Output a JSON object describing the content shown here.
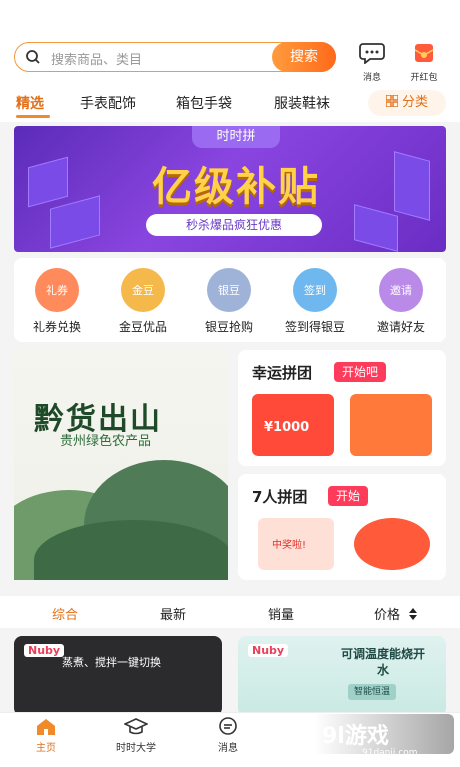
{
  "search": {
    "placeholder": "搜索商品、类目",
    "button": "搜索"
  },
  "header_icons": {
    "messages": "消息",
    "red_packet": "开红包"
  },
  "tabs": [
    {
      "label": "精选",
      "active": true
    },
    {
      "label": "手表配饰"
    },
    {
      "label": "箱包手袋"
    },
    {
      "label": "服装鞋袜"
    }
  ],
  "category_button": "分类",
  "banner": {
    "tag": "时时拼",
    "headline": "亿级补贴",
    "subtitle": "秒杀爆品疯狂优惠"
  },
  "quick_links": [
    {
      "icon_text": "礼券",
      "label": "礼券兑换",
      "color": "#ff8a5c"
    },
    {
      "icon_text": "金豆",
      "label": "金豆优品",
      "color": "#f5b84a"
    },
    {
      "icon_text": "银豆",
      "label": "银豆抢购",
      "color": "#9fb3d8"
    },
    {
      "icon_text": "签到",
      "label": "签到得银豆",
      "color": "#6fb7ef"
    },
    {
      "icon_text": "邀请",
      "label": "邀请好友",
      "color": "#b98ae8"
    }
  ],
  "promo_left": {
    "title": "黔货出山",
    "subtitle": "贵州绿色农产品"
  },
  "lucky_group": {
    "title": "幸运拼团",
    "badge": "开始吧",
    "coupon_value": "¥1000"
  },
  "seven_group": {
    "title": "7人拼团",
    "badge": "开始",
    "prize": "中奖啦!"
  },
  "sort_options": [
    {
      "label": "综合",
      "active": true
    },
    {
      "label": "最新"
    },
    {
      "label": "销量"
    },
    {
      "label": "价格"
    }
  ],
  "products": [
    {
      "brand": "Nuby",
      "text": "蒸煮、搅拌一键切换"
    },
    {
      "brand": "Nuby",
      "text": "可调温度能烧开水",
      "sub": "智能恒温"
    }
  ],
  "bottom_nav": [
    {
      "label": "主页",
      "active": true
    },
    {
      "label": "时时大学"
    },
    {
      "label": "消息"
    }
  ],
  "watermark": {
    "brand": "9l游戏",
    "site": "91danji.com"
  },
  "colors": {
    "accent": "#f08a2b",
    "badge_red": "#ff3b5c"
  }
}
